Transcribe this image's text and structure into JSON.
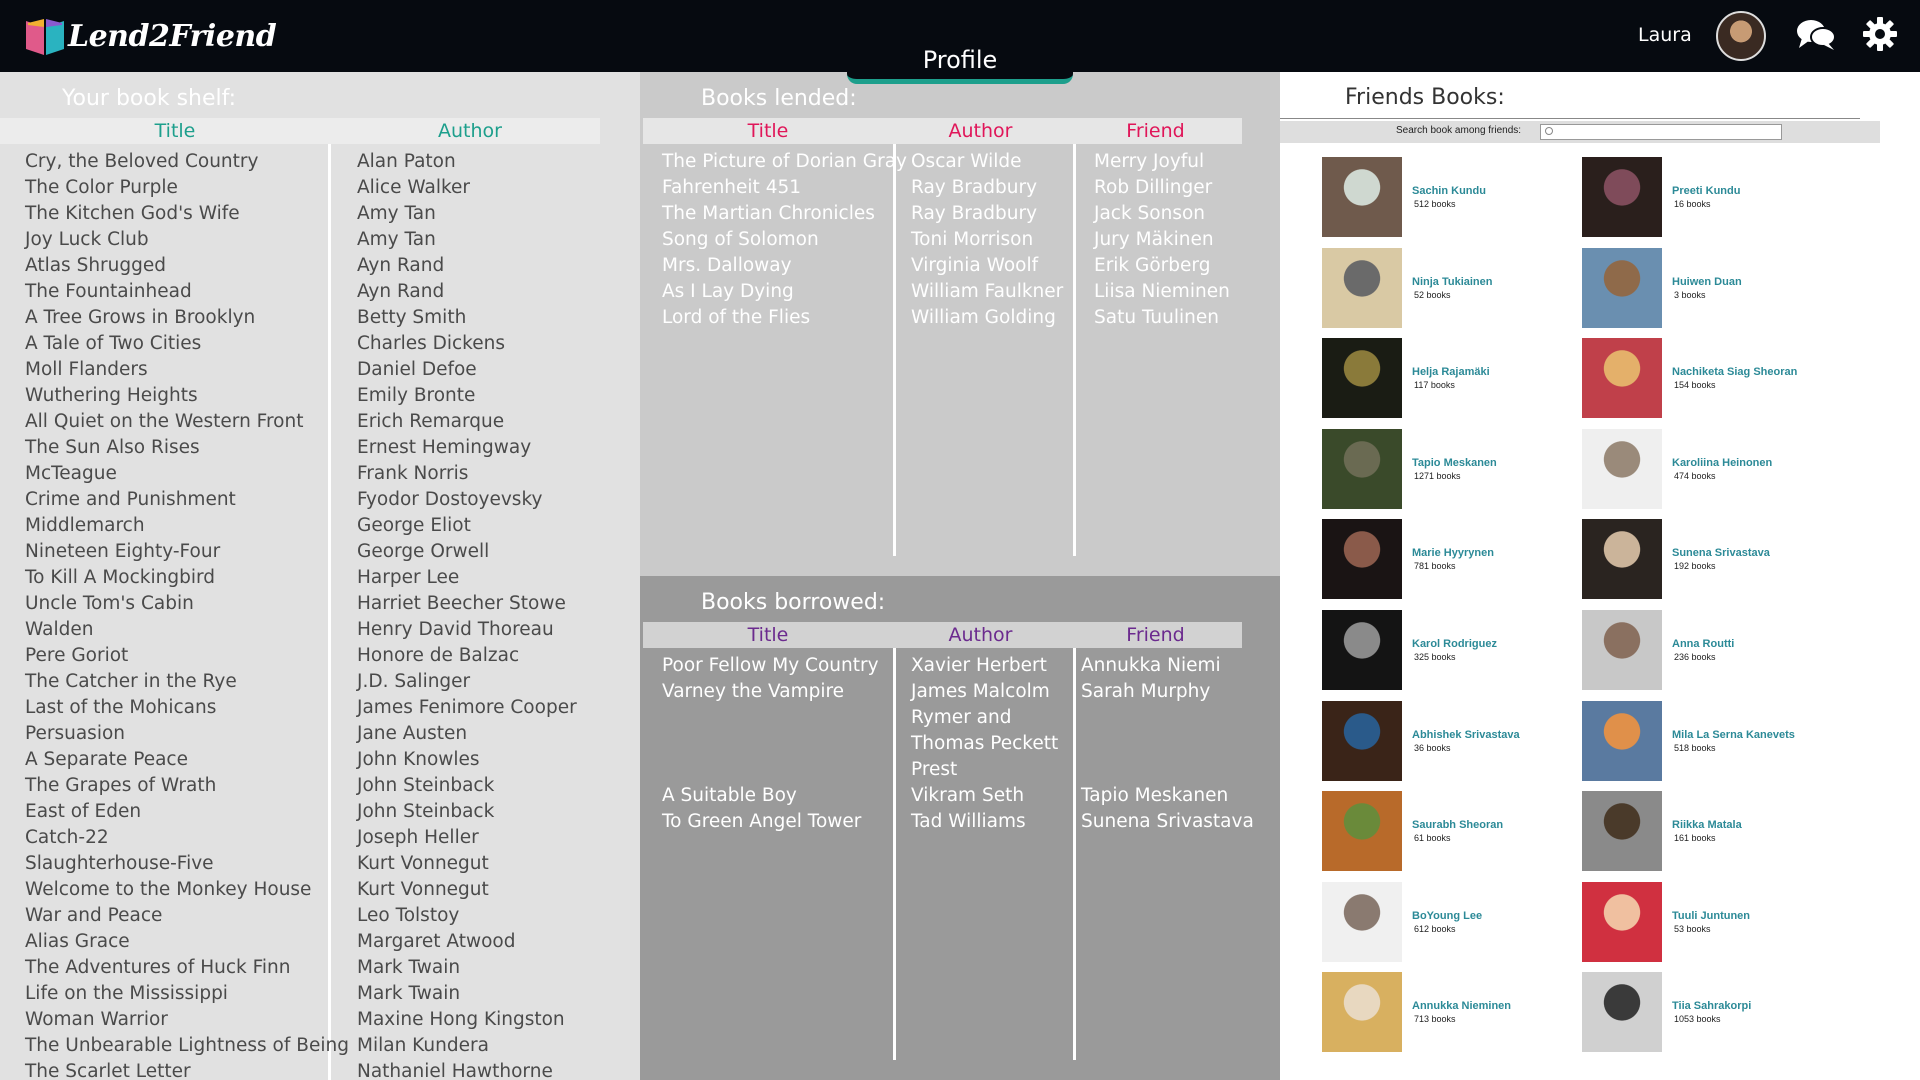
{
  "app": {
    "name": "Lend2Friend"
  },
  "header": {
    "active_tab": "Profile",
    "username": "Laura"
  },
  "icons": {
    "logo": "book-logo-icon",
    "chat": "chat-icon",
    "settings": "gear-icon"
  },
  "colors": {
    "accent": "#1d9f8c",
    "lended_header": "#e01659",
    "borrowed_header": "#6b2a8e",
    "friend_name": "#2c8a97"
  },
  "shelf": {
    "title": "Your book shelf:",
    "col_title": "Title",
    "col_author": "Author",
    "titles": [
      "Cry, the Beloved Country",
      "The Color Purple",
      "The Kitchen God's Wife",
      "Joy Luck Club",
      "Atlas Shrugged",
      "The Fountainhead",
      "A Tree Grows in Brooklyn",
      "A Tale of Two Cities",
      "Moll Flanders",
      "Wuthering Heights",
      "All Quiet on the Western Front",
      "The Sun Also Rises",
      "McTeague",
      "Crime and Punishment",
      "Middlemarch",
      "Nineteen Eighty-Four",
      "To Kill A Mockingbird",
      "Uncle Tom's Cabin",
      "Walden",
      "Pere Goriot",
      "The Catcher in the Rye",
      "Last of the Mohicans",
      "Persuasion",
      "A Separate Peace",
      "The Grapes of Wrath",
      "East of Eden",
      "Catch-22",
      "Slaughterhouse-Five",
      "Welcome to the Monkey House",
      "War and Peace",
      "Alias Grace",
      "The Adventures of Huck Finn",
      "Life on the Mississippi",
      "Woman Warrior",
      "The Unbearable Lightness of Being",
      "The Scarlet Letter"
    ],
    "authors": [
      "Alan Paton",
      "Alice Walker",
      "Amy Tan",
      "Amy Tan",
      "Ayn Rand",
      "Ayn Rand",
      "Betty Smith",
      "Charles Dickens",
      "Daniel Defoe",
      "Emily Bronte",
      "Erich Remarque",
      "Ernest Hemingway",
      "Frank Norris",
      "Fyodor Dostoyevsky",
      "George Eliot",
      "George Orwell",
      "Harper Lee",
      "Harriet Beecher Stowe",
      "Henry David Thoreau",
      "Honore de Balzac",
      "J.D. Salinger",
      "James Fenimore Cooper",
      "Jane Austen",
      "John Knowles",
      "John Steinback",
      "John Steinback",
      "Joseph Heller",
      "Kurt Vonnegut",
      "Kurt Vonnegut",
      "Leo Tolstoy",
      "Margaret Atwood",
      "Mark Twain",
      "Mark Twain",
      "Maxine Hong Kingston",
      "Milan Kundera",
      "Nathaniel Hawthorne"
    ]
  },
  "lended": {
    "title": "Books lended:",
    "col_title": "Title",
    "col_author": "Author",
    "col_friend": "Friend",
    "titles": [
      "The Picture of Dorian Gray",
      "Fahrenheit 451",
      "The Martian Chronicles",
      "Song of Solomon",
      "Mrs. Dalloway",
      "As I Lay Dying",
      "Lord of the Flies"
    ],
    "authors": [
      "Oscar Wilde",
      "Ray Bradbury",
      "Ray Bradbury",
      "Toni Morrison",
      "Virginia Woolf",
      "William Faulkner",
      "William Golding"
    ],
    "friends": [
      "Merry Joyful",
      "Rob Dillinger",
      "Jack Sonson",
      "Jury Mäkinen",
      "Erik Görberg",
      "Liisa Nieminen",
      "Satu Tuulinen"
    ]
  },
  "borrowed": {
    "title": "Books borrowed:",
    "col_title": "Title",
    "col_author": "Author",
    "col_friend": "Friend",
    "titles": [
      "Poor Fellow My Country",
      "Varney the Vampire",
      "",
      "",
      "",
      "A Suitable Boy",
      "To Green Angel Tower"
    ],
    "authors": [
      "Xavier Herbert",
      "James Malcolm",
      "Rymer and",
      "Thomas Peckett",
      "Prest",
      "Vikram Seth",
      "Tad Williams"
    ],
    "friends": [
      "Annukka Niemi",
      "Sarah Murphy",
      "",
      "",
      "",
      "Tapio Meskanen",
      "Sunena Srivastava"
    ]
  },
  "friends": {
    "title": "Friends Books:",
    "search_label": "Search book among friends:",
    "search_value": "",
    "list": [
      {
        "name": "Sachin Kundu",
        "count": "512 books",
        "c1": "#6f5a4c",
        "c2": "#cfd8d0"
      },
      {
        "name": "Preeti Kundu",
        "count": "16 books",
        "c1": "#2a1f1c",
        "c2": "#7f4b5a"
      },
      {
        "name": "Ninja Tukiainen",
        "count": "52 books",
        "c1": "#d9c9a4",
        "c2": "#6a6a6a"
      },
      {
        "name": "Huiwen Duan",
        "count": "3 books",
        "c1": "#6a8fb0",
        "c2": "#8f6a4a"
      },
      {
        "name": "Helja Rajamäki",
        "count": "117 books",
        "c1": "#1a1c14",
        "c2": "#8a7a3a"
      },
      {
        "name": "Nachiketa Siag Sheoran",
        "count": "154 books",
        "c1": "#c0404a",
        "c2": "#e4b06a"
      },
      {
        "name": "Tapio Meskanen",
        "count": "1271 books",
        "c1": "#3a4a2a",
        "c2": "#6a6a52"
      },
      {
        "name": "Karoliina Heinonen",
        "count": "474 books",
        "c1": "#efefef",
        "c2": "#9a8a7a"
      },
      {
        "name": "Marie Hyyrynen",
        "count": "781 books",
        "c1": "#1a1414",
        "c2": "#8a5a4a"
      },
      {
        "name": "Sunena Srivastava",
        "count": "192 books",
        "c1": "#2a2420",
        "c2": "#cbb49a"
      },
      {
        "name": "Karol Rodriguez",
        "count": "325 books",
        "c1": "#141414",
        "c2": "#8a8a8a"
      },
      {
        "name": "Anna Routti",
        "count": "236 books",
        "c1": "#c8c8c8",
        "c2": "#8a7060"
      },
      {
        "name": "Abhishek Srivastava",
        "count": "36 books",
        "c1": "#3a2418",
        "c2": "#2a5a8a"
      },
      {
        "name": "Mila La Serna Kanevets",
        "count": "518 books",
        "c1": "#5a7aa0",
        "c2": "#e0904a"
      },
      {
        "name": "Saurabh Sheoran",
        "count": "61 books",
        "c1": "#b86a2a",
        "c2": "#6a8a3a"
      },
      {
        "name": "Riikka Matala",
        "count": "161 books",
        "c1": "#8a8a8a",
        "c2": "#4a3a2a"
      },
      {
        "name": "BoYoung Lee",
        "count": "612 books",
        "c1": "#f0f0f0",
        "c2": "#8a7a70"
      },
      {
        "name": "Tuuli Juntunen",
        "count": "53 books",
        "c1": "#d03040",
        "c2": "#f0c0a0"
      },
      {
        "name": "Annukka Nieminen",
        "count": "713 books",
        "c1": "#d8b060",
        "c2": "#e8d8c0"
      },
      {
        "name": "Tiia Sahrakorpi",
        "count": "1053 books",
        "c1": "#d0d0d0",
        "c2": "#3a3a3a"
      }
    ]
  }
}
